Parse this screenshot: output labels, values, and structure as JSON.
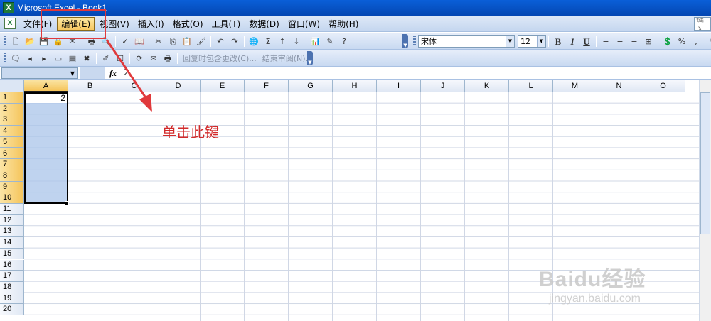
{
  "title_bar": {
    "title": "Microsoft Excel - Book1",
    "app_icon": "excel-icon"
  },
  "menu": {
    "items": [
      {
        "label": "文件(F)"
      },
      {
        "label": "编辑(E)",
        "active": true
      },
      {
        "label": "视图(V)"
      },
      {
        "label": "插入(I)"
      },
      {
        "label": "格式(O)"
      },
      {
        "label": "工具(T)"
      },
      {
        "label": "数据(D)"
      },
      {
        "label": "窗口(W)"
      },
      {
        "label": "帮助(H)"
      }
    ],
    "help_box_text": "键入"
  },
  "toolbar": {
    "font_name": "宋体",
    "font_size": "12",
    "bold": "B",
    "italic": "I",
    "underline": "U",
    "percent": "%",
    "sigma": "Σ",
    "review_reply": "回复时包含更改(C)...",
    "review_end": "结束审阅(N)..."
  },
  "formula_bar": {
    "name_box": "",
    "fx": "fx",
    "content": "2"
  },
  "sheet": {
    "columns": [
      "A",
      "B",
      "C",
      "D",
      "E",
      "F",
      "G",
      "H",
      "I",
      "J",
      "K",
      "L",
      "M",
      "N",
      "O"
    ],
    "rows": [
      "1",
      "2",
      "3",
      "4",
      "5",
      "6",
      "7",
      "8",
      "9",
      "10",
      "11",
      "12",
      "13",
      "14",
      "15",
      "16",
      "17",
      "18",
      "19",
      "20"
    ],
    "selected_column": "A",
    "selected_rows": [
      "1",
      "2",
      "3",
      "4",
      "5",
      "6",
      "7",
      "8",
      "9",
      "10"
    ],
    "cell_A1": "2"
  },
  "annotation": {
    "text": "单击此键",
    "color": "#d22b2b"
  },
  "watermark": {
    "brand": "Baidu经验",
    "url": "jingyan.baidu.com"
  }
}
